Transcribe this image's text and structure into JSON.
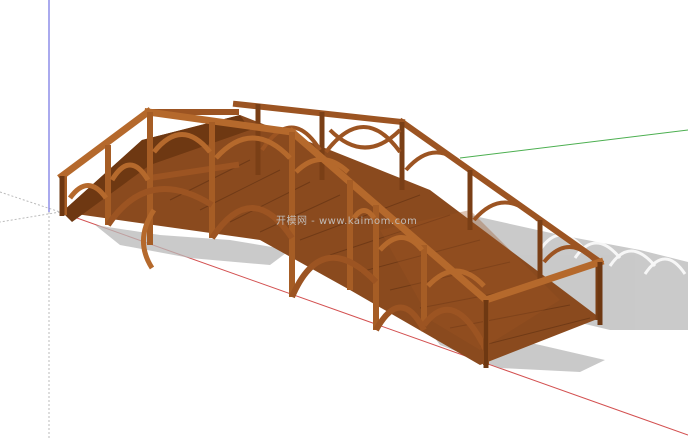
{
  "scene": {
    "subject": "wooden-arched-footbridge",
    "watermark": "开模网 - www.kaimom.com",
    "colors": {
      "background": "#ffffff",
      "wood_light": "#b5692c",
      "wood_mid": "#9c5422",
      "wood_dark": "#6e3812",
      "deck": "#8a4a1e",
      "deck_planks": "#5c2e10",
      "shadow": "#b8b8b8",
      "axis_red": "#d35050",
      "axis_green": "#4caf50",
      "axis_blue": "#5555dd",
      "axis_dotted": "#bbbbbb"
    }
  }
}
